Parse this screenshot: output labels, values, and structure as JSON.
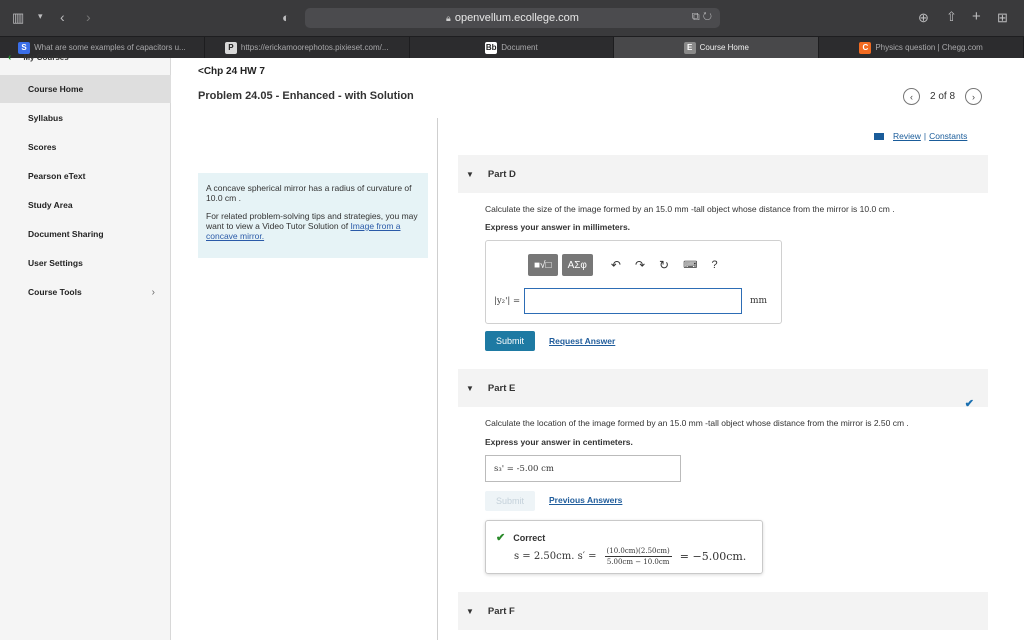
{
  "browser": {
    "url": "openvellum.ecollege.com",
    "tabs": [
      {
        "favicon": "S",
        "favicon_color": "#3a6ee8",
        "label": "What are some examples of capacitors u..."
      },
      {
        "favicon": "P",
        "favicon_color": "#d8d8d8",
        "label": "https://ericka​moorephotos.pixieset.com/..."
      },
      {
        "favicon": "Bb",
        "favicon_color": "#ffffff",
        "label": "Document"
      },
      {
        "favicon": "E",
        "favicon_color": "#8a8a8a",
        "label": "Course Home"
      },
      {
        "favicon": "C",
        "favicon_color": "#f26b21",
        "label": "Physics question | Chegg.com"
      }
    ],
    "active_tab_index": 3
  },
  "sidebar": {
    "my_courses": "My Courses",
    "items": [
      {
        "label": "Course Home"
      },
      {
        "label": "Syllabus"
      },
      {
        "label": "Scores"
      },
      {
        "label": "Pearson eText"
      },
      {
        "label": "Study Area"
      },
      {
        "label": "Document Sharing"
      },
      {
        "label": "User Settings"
      },
      {
        "label": "Course Tools"
      }
    ]
  },
  "header": {
    "back_link": "<Chp 24 HW 7",
    "problem_title": "Problem 24.05 - Enhanced - with Solution",
    "pager_text": "2 of 8",
    "review": "Review",
    "separator": "|",
    "constants": "Constants"
  },
  "info": {
    "line1": "A concave spherical mirror has a radius of curvature of 10.0 cm .",
    "line2_prefix": "For related problem-solving tips and strategies, you may want to view a Video Tutor Solution of ",
    "line2_link": "Image from a concave mirror."
  },
  "partD": {
    "title": "Part D",
    "question": "Calculate the size of the image formed by an 15.0 mm -tall object whose distance from the mirror is 10.0 cm .",
    "instruction": "Express your answer in millimeters.",
    "lhs": "|y₂'| =",
    "unit": "mm",
    "input_value": "",
    "toolbar_labels": [
      "■√□",
      "AΣφ"
    ],
    "help": "?",
    "submit": "Submit",
    "request": "Request Answer"
  },
  "partE": {
    "title": "Part E",
    "question": "Calculate the location of the image formed by an 15.0 mm -tall object whose distance from the mirror is 2.50 cm .",
    "instruction": "Express your answer in centimeters.",
    "answer": "s₃' =  -5.00  cm",
    "submit": "Submit",
    "previous": "Previous Answers",
    "correct_label": "Correct",
    "eq_lhs": "s = 2.50cm. s′ =",
    "eq_num": "(10.0cm)(2.50cm)",
    "eq_den": "5.00cm − 10.0cm",
    "eq_result": "= −5.00cm."
  },
  "partF": {
    "title": "Part F"
  }
}
